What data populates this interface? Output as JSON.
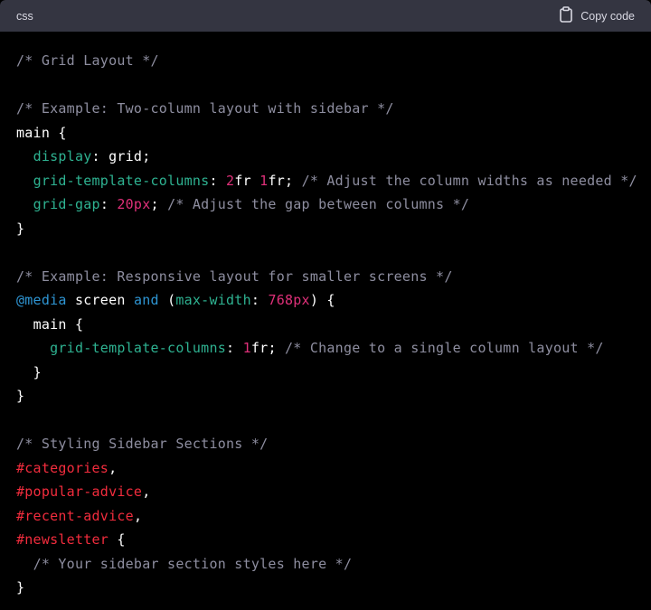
{
  "header": {
    "language": "css",
    "copy_label": "Copy code",
    "copy_icon": "clipboard-icon"
  },
  "colors": {
    "header_bg": "#343541",
    "code_bg": "#000000",
    "comment": "#8e8ea0",
    "property": "#2eb291",
    "number": "#df3079",
    "keyword": "#2e95d3",
    "selector_id": "#f22c3d",
    "text": "#ffffff"
  },
  "code": {
    "l1": "/* Grid Layout */",
    "l3": "/* Example: Two-column layout with sidebar */",
    "l4_sel": "main",
    "brace_open": "{",
    "brace_close": "}",
    "colon": ":",
    "semi": ";",
    "l5_prop": "display",
    "l5_val": "grid",
    "l6_prop": "grid-template-columns",
    "l6_n1": "2",
    "l6_u1": "fr",
    "l6_n2": "1",
    "l6_u2": "fr",
    "l6_comment": "/* Adjust the column widths as needed */",
    "l7_prop": "grid-gap",
    "l7_val": "20px",
    "l7_comment": "/* Adjust the gap between columns */",
    "l10": "/* Example: Responsive layout for smaller screens */",
    "l11_at": "@media",
    "l11_screen": "screen",
    "l11_and": "and",
    "l11_prop": "max-width",
    "l11_val": "768px",
    "l12_sel": "main",
    "l13_prop": "grid-template-columns",
    "l13_n": "1",
    "l13_u": "fr",
    "l13_comment": "/* Change to a single column layout */",
    "l17": "/* Styling Sidebar Sections */",
    "l18": "#categories",
    "l19": "#popular-advice",
    "l20": "#recent-advice",
    "l21": "#newsletter",
    "l22": "/* Your sidebar section styles here */"
  }
}
